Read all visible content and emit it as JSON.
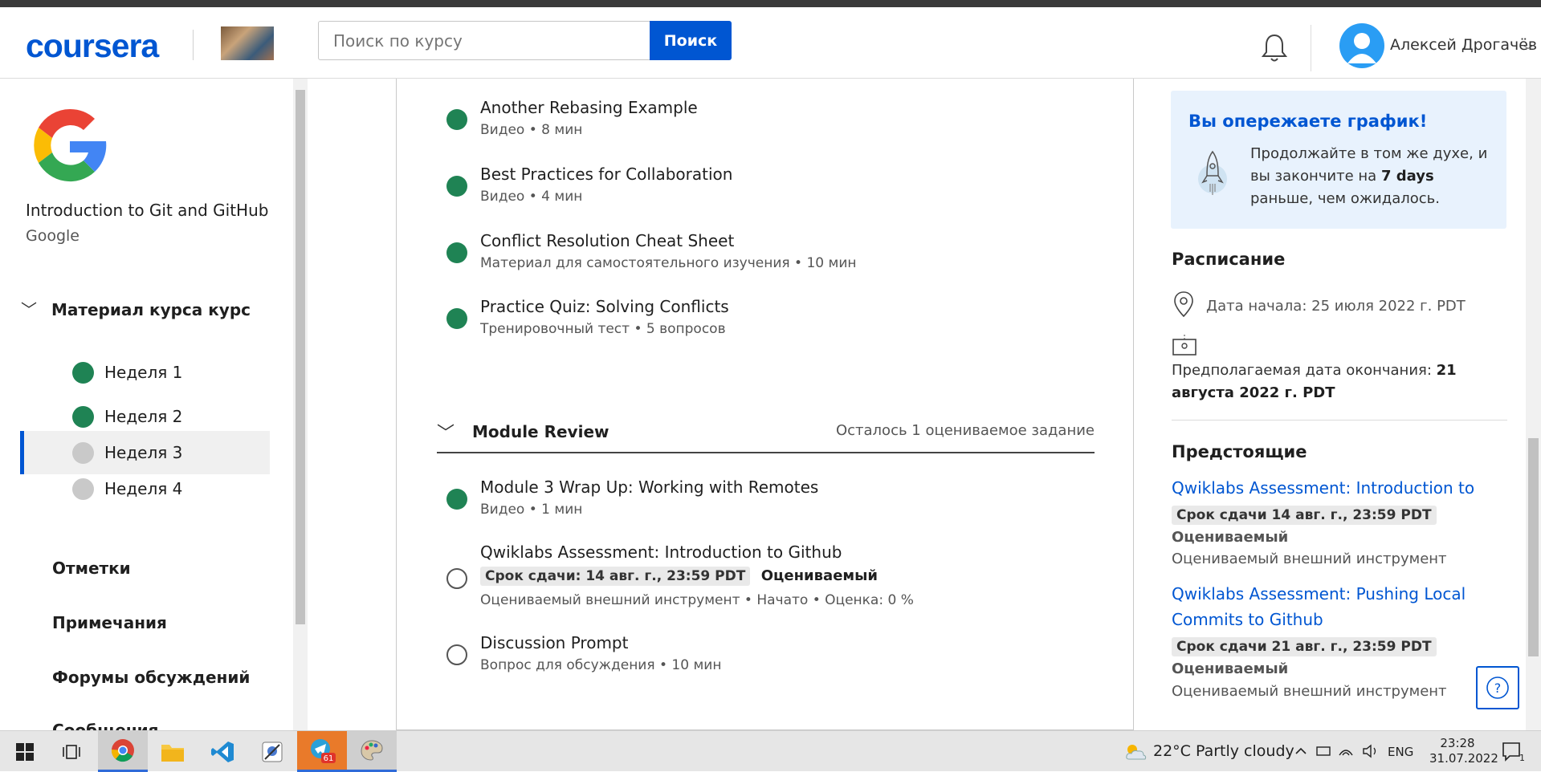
{
  "header": {
    "logo": "coursera",
    "search_placeholder": "Поиск по курсу",
    "search_button": "Поиск",
    "user_name": "Алексей Дрогачёв",
    "user_chevron": "﹀"
  },
  "sidebar": {
    "course_title": "Introduction to Git and GitHub",
    "course_org": "Google",
    "section_label": "Материал курса курс",
    "section_chevron": "﹀",
    "weeks": [
      {
        "label": "Неделя 1",
        "status": "done"
      },
      {
        "label": "Неделя 2",
        "status": "done"
      },
      {
        "label": "Неделя 3",
        "status": "todo"
      },
      {
        "label": "Неделя 4",
        "status": "todo"
      }
    ],
    "links": [
      "Отметки",
      "Примечания",
      "Форумы обсуждений",
      "Сообщения"
    ]
  },
  "main": {
    "items_top": [
      {
        "title": "Another Rebasing Example",
        "sub": "Видео • 8 мин"
      },
      {
        "title": "Best Practices for Collaboration",
        "sub": "Видео • 4 мин"
      },
      {
        "title": "Conflict Resolution Cheat Sheet",
        "sub": "Материал для самостоятельного изучения • 10 мин"
      },
      {
        "title": "Practice Quiz: Solving Conflicts",
        "sub": "Тренировочный тест • 5 вопросов"
      }
    ],
    "module": {
      "title": "Module Review",
      "remaining": "Осталось 1 оцениваемое задание",
      "chevron": "﹀"
    },
    "items_module": [
      {
        "title": "Module 3 Wrap Up: Working with Remotes",
        "sub": "Видео • 1 мин"
      },
      {
        "title": "Qwiklabs Assessment: Introduction to Github",
        "deadline": "Срок сдачи: 14 авг. г., 23:59 PDT",
        "graded": "Оцениваемый",
        "sub": "Оцениваемый внешний инструмент • Начато • Оценка: 0 %"
      },
      {
        "title": "Discussion Prompt",
        "sub": "Вопрос для обсуждения • 10 мин"
      }
    ]
  },
  "right": {
    "ahead_title": "Вы опережаете график!",
    "ahead_pre": "Продолжайте в том же духе, и вы закончите на ",
    "ahead_bold": "7 days",
    "ahead_post": " раньше, чем ожидалось.",
    "schedule_title": "Расписание",
    "start_date": "Дата начала: 25 июля 2022 г. PDT",
    "end_label": "Предполагаемая дата окончания: ",
    "end_value": "21 августа 2022 г. PDT",
    "upcoming_title": "Предстоящие",
    "upcoming": [
      {
        "title": "Qwiklabs Assessment: Introduction to Github",
        "deadline": "Срок сдачи 14 авг. г., 23:59 PDT",
        "graded": "Оцениваемый",
        "tool": "Оцениваемый внешний инструмент"
      },
      {
        "title": "Qwiklabs Assessment: Pushing Local Commits to Github",
        "deadline": "Срок сдачи 21 авг. г., 23:59 PDT",
        "graded": "Оцениваемый",
        "tool": "Оцениваемый внешний инструмент"
      }
    ],
    "help": "?"
  },
  "taskbar": {
    "weather": "22°C  Partly cloudy",
    "lang": "ENG",
    "time": "23:28",
    "date": "31.07.2022",
    "badge": "61",
    "notif_count": "1"
  },
  "colors": {
    "brand": "#0056d2",
    "done": "#1f8354"
  }
}
